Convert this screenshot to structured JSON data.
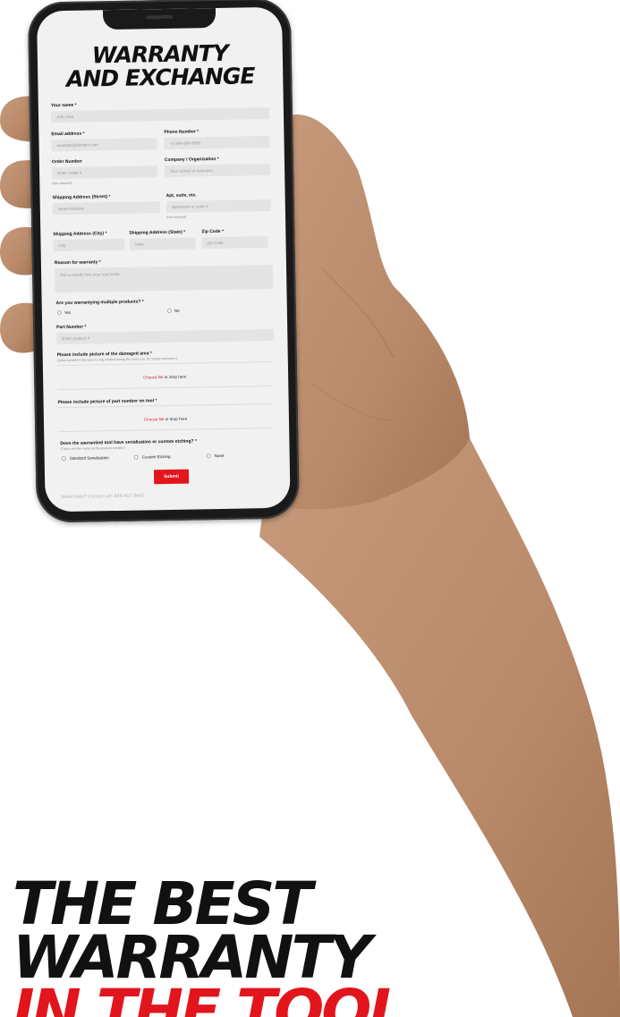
{
  "form": {
    "title_line1": "WARRANTY",
    "title_line2": "AND EXCHANGE",
    "name_label": "Your name *",
    "name_placeholder": "John Doe",
    "email_label": "Email address *",
    "email_placeholder": "example@domain.com",
    "phone_label": "Phone Number *",
    "phone_placeholder": "+1 999-999-9999",
    "order_label": "Order Number",
    "order_placeholder": "Enter Order #",
    "order_hint": "(Not required)",
    "company_label": "Company / Organization *",
    "company_placeholder": "Your school or business",
    "street_label": "Shipping Address (Street) *",
    "street_placeholder": "Street Address",
    "apt_label": "Apt, suite, etc.",
    "apt_placeholder": "Apartment or suite #",
    "apt_hint": "(Not required)",
    "city_label": "Shipping Address (City) *",
    "city_placeholder": "City",
    "state_label": "Shipping Address (State) *",
    "state_placeholder": "State",
    "zip_label": "Zip Code *",
    "zip_placeholder": "Zip Code",
    "reason_label": "Reason for warranty *",
    "reason_placeholder": "Tell us briefly how your tool broke",
    "multiple_label": "Are you warrantying multiple products? *",
    "multiple_options": [
      "Yes",
      "No"
    ],
    "part_label": "Part Number *",
    "part_placeholder": "Enter product #",
    "damage_label": "Please include picture of the damaged area *",
    "damage_hint": "(Video needed if the issue is only evident during the tool's use. IE: torque wrenches.)",
    "choose_file": "Choose file",
    "or_drop": " or drop here",
    "partpic_label": "Please include picture of part number on tool *",
    "serial_label": "Does the warrantied tool have serialization or custom etching? *",
    "serial_hint": "(This is not the same as the product number.)",
    "serial_options": [
      "Standard Serialization",
      "Custom Etching",
      "None"
    ],
    "submit_label": "Submit",
    "help_text": "Need help? Contact us! 844-407-6642"
  },
  "headline": {
    "line1": "THE BEST",
    "line2": "WARRANTY",
    "line3": "IN THE TOOL"
  },
  "colors": {
    "accent": "#e2151c",
    "text": "#111111",
    "skin": "#b98a6c"
  }
}
